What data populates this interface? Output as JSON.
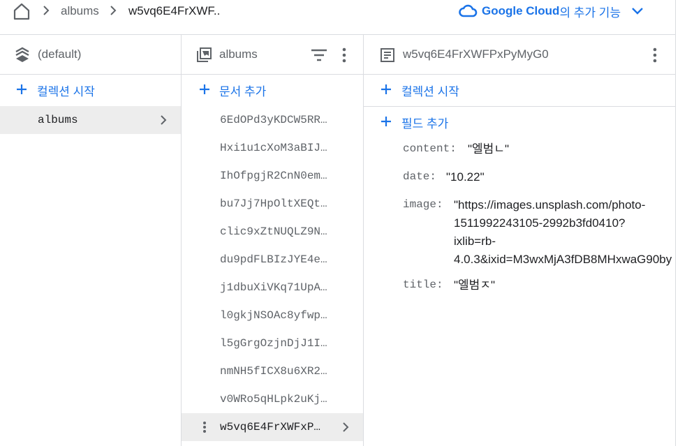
{
  "breadcrumb": {
    "items": [
      "albums",
      "w5vq6E4FrXWF.."
    ]
  },
  "google_cloud": {
    "label": "Google Cloud",
    "more": "의 추가 기능"
  },
  "panel_root": {
    "title": "(default)",
    "add_label": "컬렉션 시작",
    "items": [
      {
        "label": "albums"
      }
    ]
  },
  "panel_collection": {
    "title": "albums",
    "add_label": "문서 추가",
    "documents": [
      "6EdOPd3yKDCW5RR…",
      "Hxi1u1cXoM3aBIJ…",
      "IhOfpgjR2CnN0em…",
      "bu7Jj7HpOltXEQt…",
      "clic9xZtNUQLZ9N…",
      "du9pdFLBIzJYE4e…",
      "j1dbuXiVKq71UpA…",
      "l0gkjNSOAc8yfwp…",
      "l5gGrgOzjnDjJ1I…",
      "nmNH5fICX8u6XR2…",
      "v0WRo5qHLpk2uKj…",
      "w5vq6E4FrXWFxP…"
    ]
  },
  "panel_document": {
    "title": "w5vq6E4FrXWFPxPyMyG0",
    "add_collection_label": "컬렉션 시작",
    "add_field_label": "필드 추가",
    "fields": [
      {
        "key": "content:",
        "value": "\"엘범ㄴ\""
      },
      {
        "key": "date:",
        "value": "\"10.22\""
      },
      {
        "key": "image:",
        "lines": [
          "\"https://images.unsplash.com/photo-",
          "1511992243105-2992b3fd0410?",
          "ixlib=rb-",
          "4.0.3&ixid=M3wxMjA3fDB8MHxwaG90by"
        ]
      },
      {
        "key": "title:",
        "value": "\"엘범ㅈ\""
      }
    ]
  },
  "colors": {
    "accent": "#1a73e8",
    "selected_bg": "#ededed",
    "border": "#dadce0"
  }
}
